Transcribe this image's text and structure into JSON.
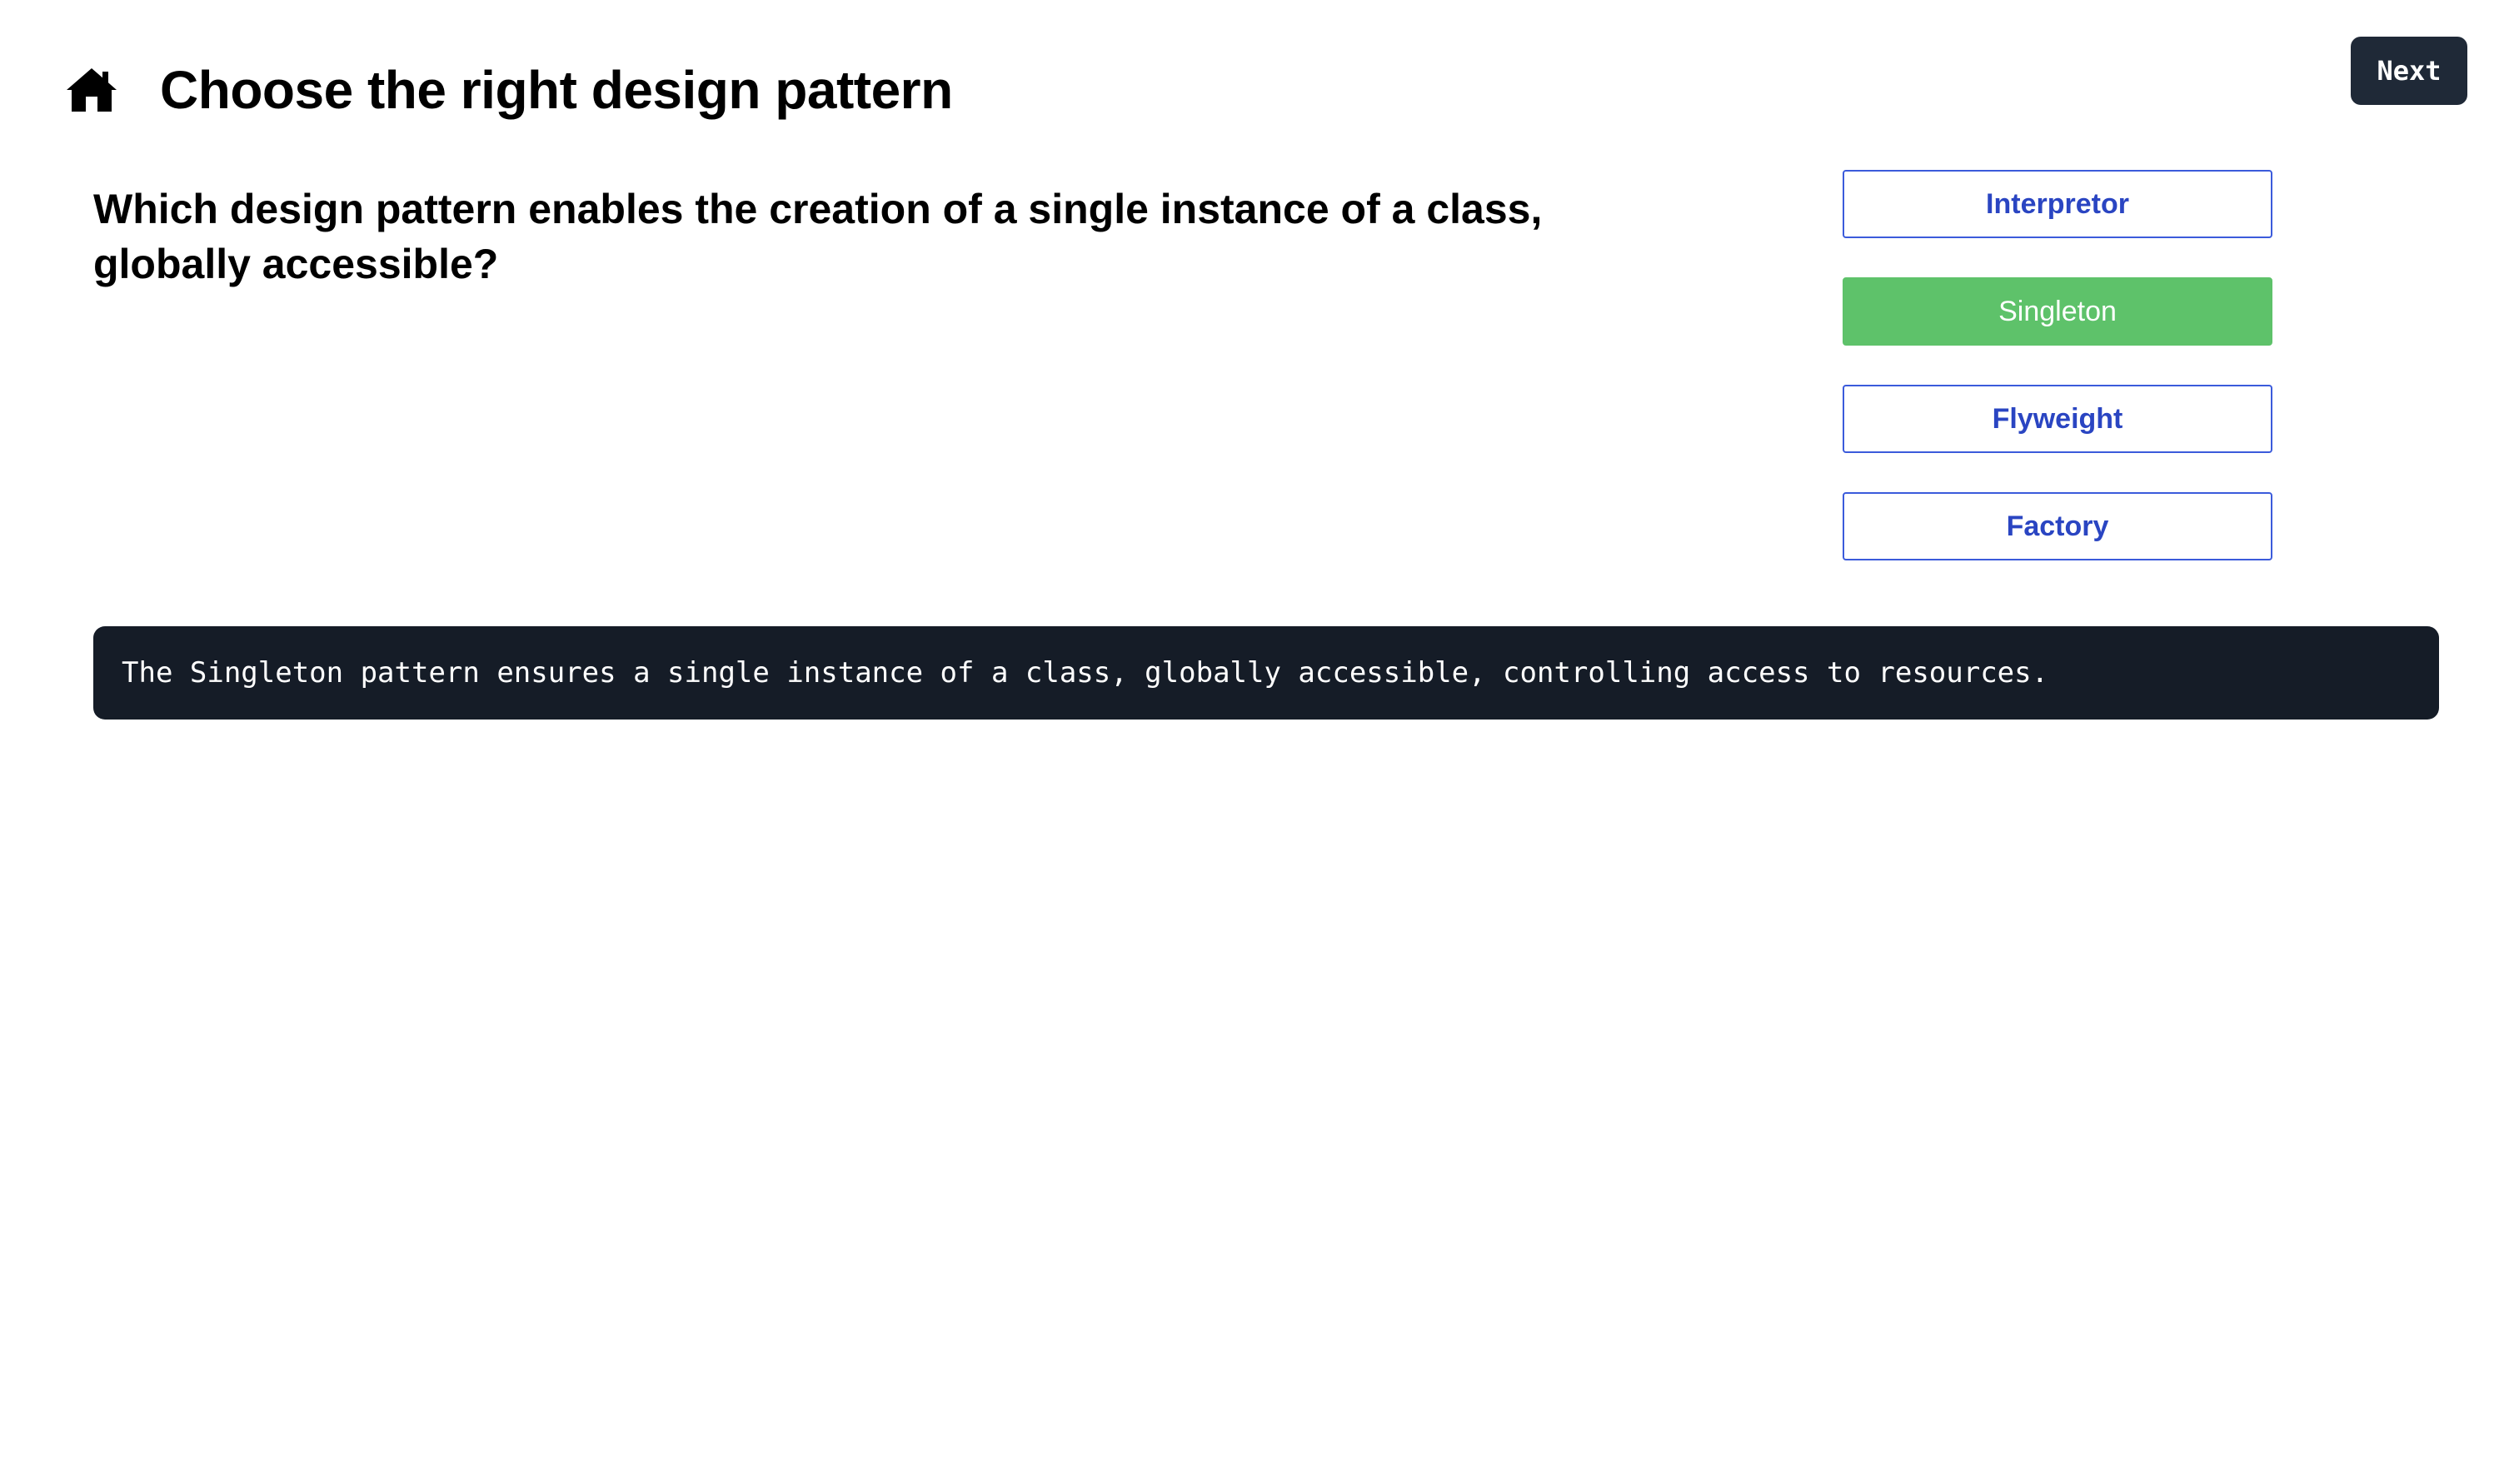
{
  "header": {
    "title": "Choose the right design pattern",
    "home_icon": "home-icon"
  },
  "toolbar": {
    "next_label": "Next"
  },
  "quiz": {
    "question": "Which design pattern enables the creation of a single instance of a class, globally accessible?",
    "options": [
      {
        "label": "Interpretor",
        "state": "default"
      },
      {
        "label": "Singleton",
        "state": "correct"
      },
      {
        "label": "Flyweight",
        "state": "default"
      },
      {
        "label": "Factory",
        "state": "default"
      }
    ],
    "explanation": "The Singleton pattern ensures a single instance of a class, globally accessible, controlling access to resources."
  },
  "colors": {
    "accent": "#2a45c2",
    "correct": "#5ec26a",
    "dark_panel": "#151c27",
    "button_dark": "#1f2937"
  }
}
